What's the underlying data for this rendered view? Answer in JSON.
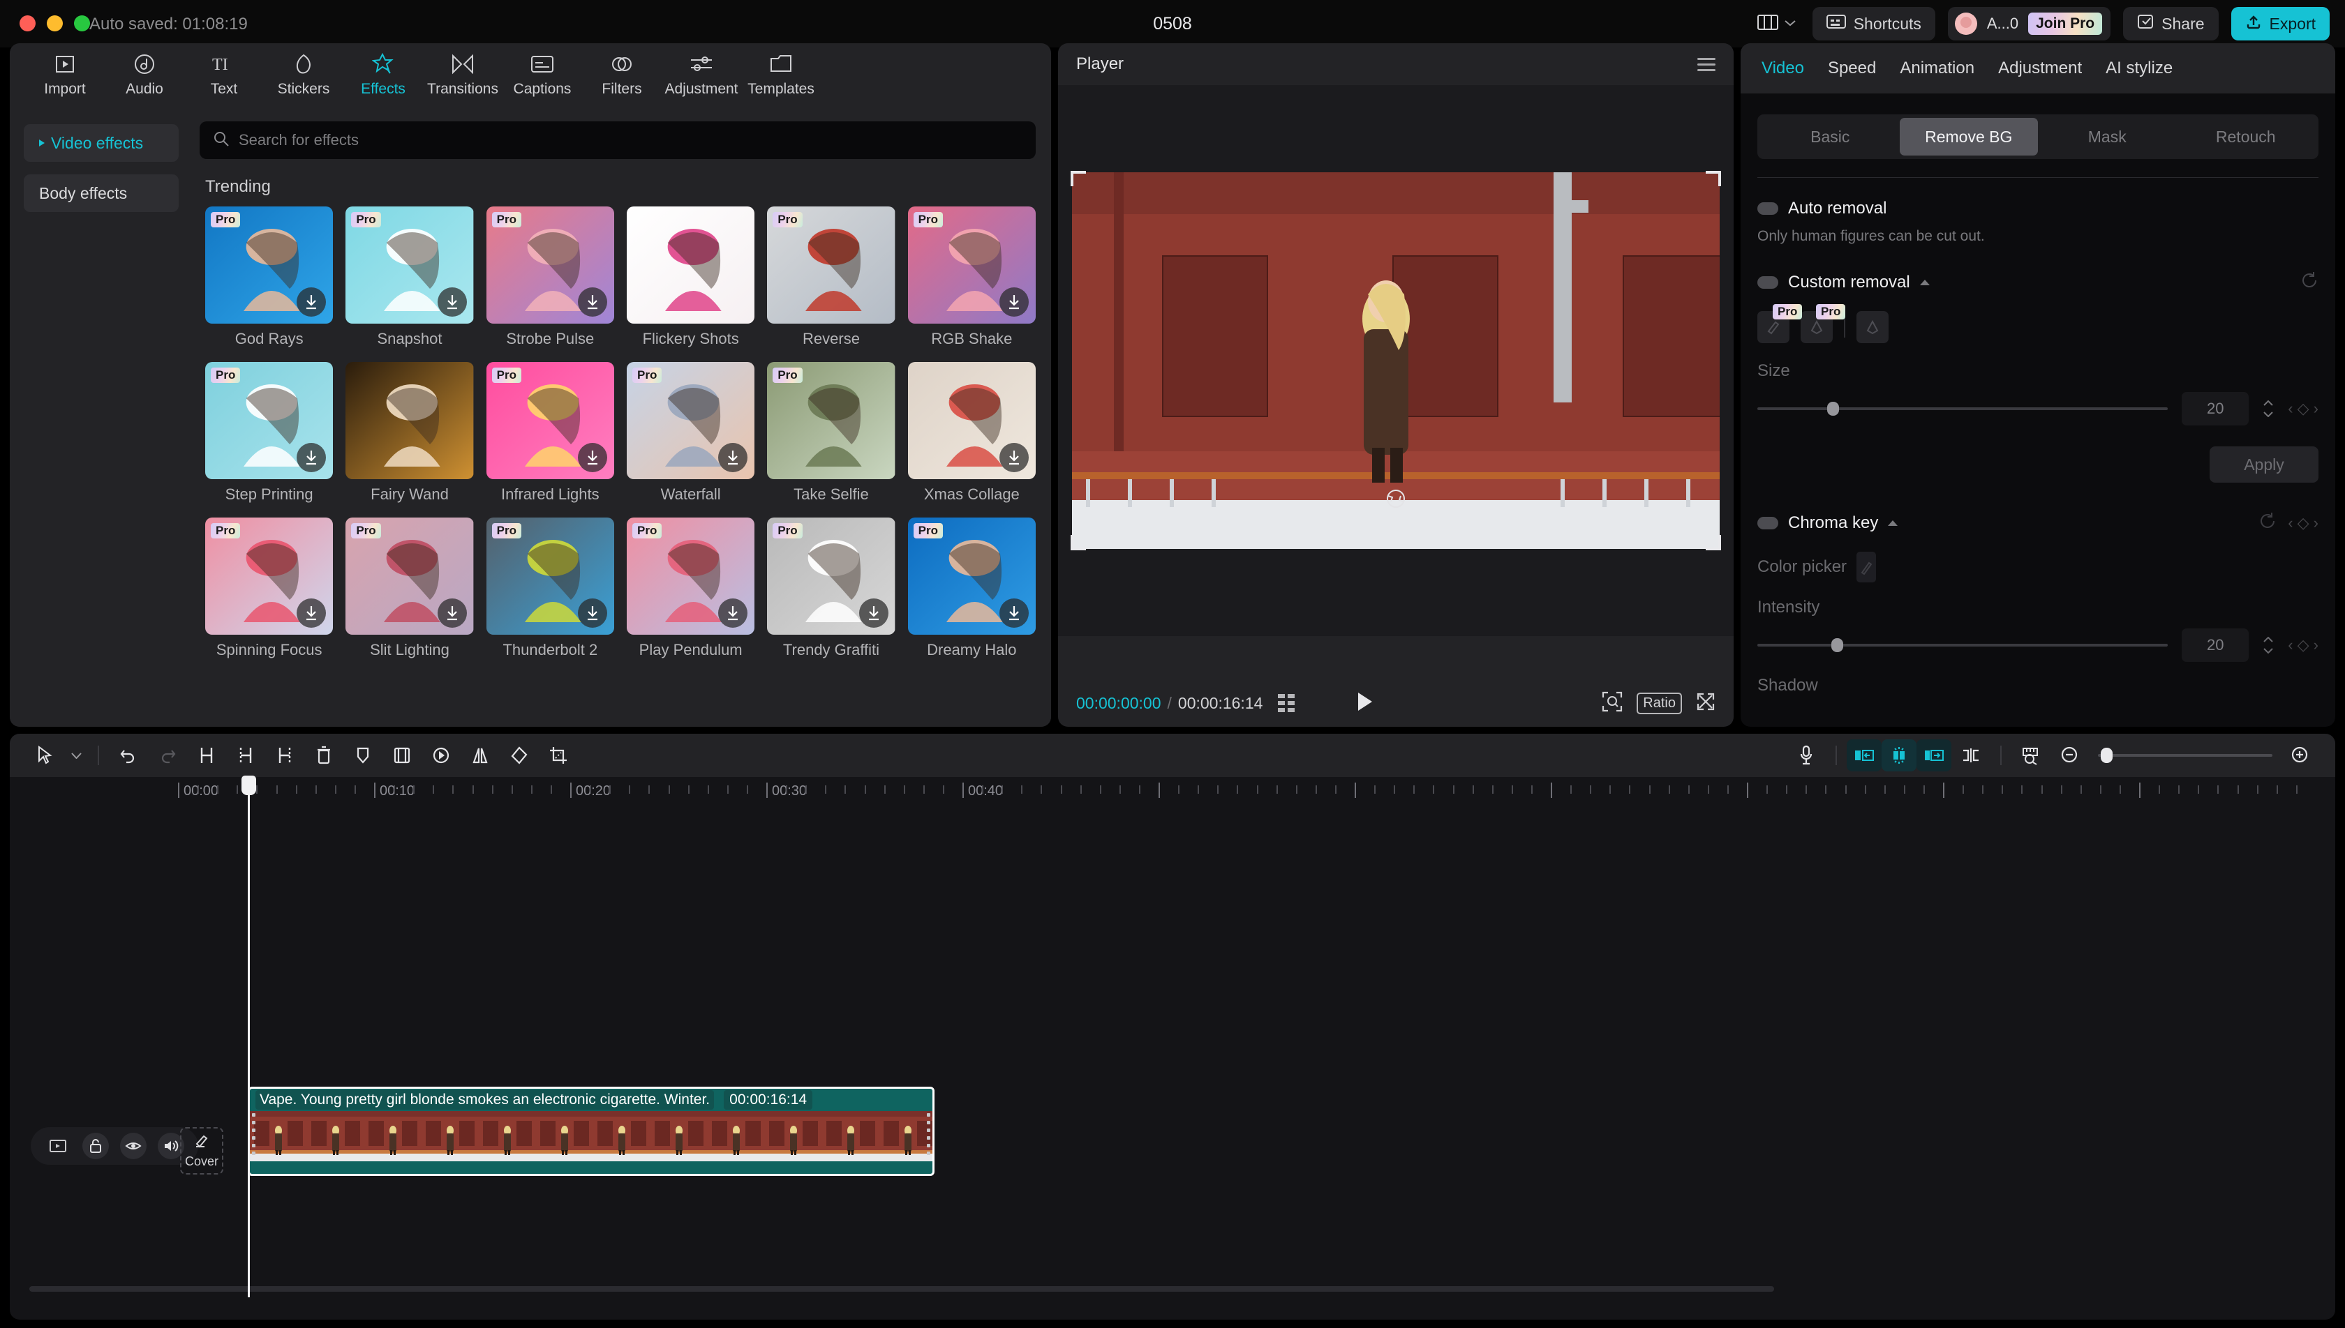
{
  "titlebar": {
    "autosave": "Auto saved: 01:08:19",
    "project_title": "0508",
    "layout_icon": "layout-icon",
    "chevron_icon": "chevron-down-icon",
    "shortcuts_label": "Shortcuts",
    "shortcuts_icon": "keyboard-icon",
    "account_name": "A...0",
    "join_pro_label": "Join Pro",
    "share_label": "Share",
    "share_icon": "share-icon",
    "export_label": "Export",
    "export_icon": "upload-icon",
    "accent_color": "#16c2d4"
  },
  "modebar": {
    "items": [
      {
        "label": "Import",
        "icon": "import-icon",
        "active": false
      },
      {
        "label": "Audio",
        "icon": "audio-note-icon",
        "active": false
      },
      {
        "label": "Text",
        "icon": "text-ti-icon",
        "active": false
      },
      {
        "label": "Stickers",
        "icon": "sticker-icon",
        "active": false
      },
      {
        "label": "Effects",
        "icon": "effects-star-icon",
        "active": true
      },
      {
        "label": "Transitions",
        "icon": "transitions-icon",
        "active": false
      },
      {
        "label": "Captions",
        "icon": "captions-icon",
        "active": false
      },
      {
        "label": "Filters",
        "icon": "filters-icon",
        "active": false
      },
      {
        "label": "Adjustment",
        "icon": "adjustment-sliders-icon",
        "active": false
      },
      {
        "label": "Templates",
        "icon": "templates-icon",
        "active": false
      }
    ]
  },
  "effects_panel": {
    "categories": [
      {
        "label": "Video effects",
        "selected": true
      },
      {
        "label": "Body effects",
        "selected": false
      }
    ],
    "search": {
      "placeholder": "Search for effects",
      "value": "",
      "icon": "search-icon"
    },
    "section_title": "Trending",
    "pro_badge": "Pro",
    "download_icon": "download-icon",
    "items": [
      {
        "name": "God Rays",
        "pro": true,
        "download": true,
        "c1": "#1277c4",
        "c2": "#2fa5e8",
        "skin": "#e7b99a"
      },
      {
        "name": "Snapshot",
        "pro": true,
        "download": true,
        "c1": "#7fd8e4",
        "c2": "#a9e7ef",
        "skin": "#ffffff"
      },
      {
        "name": "Strobe Pulse",
        "pro": true,
        "download": true,
        "c1": "#e87a88",
        "c2": "#9f86d8",
        "skin": "#f2b1b9"
      },
      {
        "name": "Flickery Shots",
        "pro": false,
        "download": false,
        "c1": "#ffffff",
        "c2": "#f6f0f2",
        "skin": "#e0448a"
      },
      {
        "name": "Reverse",
        "pro": true,
        "download": false,
        "c1": "#d6d8da",
        "c2": "#b4bcc6",
        "skin": "#c0392b"
      },
      {
        "name": "RGB Shake",
        "pro": true,
        "download": true,
        "c1": "#e36a87",
        "c2": "#8f7ac8",
        "skin": "#f4a6b0"
      },
      {
        "name": "Step Printing",
        "pro": true,
        "download": true,
        "c1": "#7fd0dd",
        "c2": "#a7e3ec",
        "skin": "#ffffff"
      },
      {
        "name": "Fairy Wand",
        "pro": false,
        "download": false,
        "c1": "#2a1c0c",
        "c2": "#cf9132",
        "skin": "#f0dcc2"
      },
      {
        "name": "Infrared Lights",
        "pro": true,
        "download": true,
        "c1": "#ff4d9e",
        "c2": "#ff7ec0",
        "skin": "#ffd36b"
      },
      {
        "name": "Waterfall",
        "pro": true,
        "download": true,
        "c1": "#c6d3e6",
        "c2": "#e9c4ae",
        "skin": "#9aa7bd"
      },
      {
        "name": "Take Selfie",
        "pro": true,
        "download": false,
        "c1": "#8b9a74",
        "c2": "#c9d6c0",
        "skin": "#6b7a55"
      },
      {
        "name": "Xmas Collage",
        "pro": false,
        "download": true,
        "c1": "#ded3c8",
        "c2": "#efe7dd",
        "skin": "#d94f45"
      },
      {
        "name": "Spinning Focus",
        "pro": true,
        "download": true,
        "c1": "#ef8fa2",
        "c2": "#cfd6ec",
        "skin": "#e9566f"
      },
      {
        "name": "Slit Lighting",
        "pro": true,
        "download": true,
        "c1": "#d8a3ad",
        "c2": "#b9a8c4",
        "skin": "#bf4d63"
      },
      {
        "name": "Thunderbolt 2",
        "pro": true,
        "download": true,
        "c1": "#55606a",
        "c2": "#3aa0d6",
        "skin": "#cdd93a"
      },
      {
        "name": "Play Pendulum",
        "pro": true,
        "download": true,
        "c1": "#ef8fa2",
        "c2": "#b9bfe2",
        "skin": "#e55f7a"
      },
      {
        "name": "Trendy Graffiti",
        "pro": true,
        "download": true,
        "c1": "#b9b9b9",
        "c2": "#d7d7d7",
        "skin": "#ffffff"
      },
      {
        "name": "Dreamy Halo",
        "pro": true,
        "download": true,
        "c1": "#0d6cc0",
        "c2": "#2f9ce4",
        "skin": "#e7b99a"
      }
    ]
  },
  "player": {
    "title": "Player",
    "menu_icon": "hamburger-menu-icon",
    "rotate_icon": "rotate-icon",
    "current_time": "00:00:00:00",
    "time_separator": "/",
    "total_time": "00:00:16:14",
    "quality_icon": "quality-grid-icon",
    "play_icon": "play-icon",
    "zoom_icon": "zoom-fit-icon",
    "ratio_label": "Ratio",
    "fullscreen_icon": "fullscreen-icon"
  },
  "properties": {
    "tabs": [
      {
        "label": "Video",
        "active": true
      },
      {
        "label": "Speed",
        "active": false
      },
      {
        "label": "Animation",
        "active": false
      },
      {
        "label": "Adjustment",
        "active": false
      },
      {
        "label": "AI stylize",
        "active": false
      }
    ],
    "segments": [
      {
        "label": "Basic",
        "active": false
      },
      {
        "label": "Remove BG",
        "active": true
      },
      {
        "label": "Mask",
        "active": false
      },
      {
        "label": "Retouch",
        "active": false
      }
    ],
    "auto_removal": {
      "label": "Auto removal",
      "enabled": false,
      "hint": "Only human figures can be cut out."
    },
    "custom_removal": {
      "label": "Custom removal",
      "enabled": false,
      "collapse_icon": "triangle-up-icon",
      "reset_icon": "reset-icon",
      "tools": [
        {
          "icon": "brush-keep-icon",
          "pro": true
        },
        {
          "icon": "brush-erase-icon",
          "pro": true
        },
        {
          "icon": "eraser-icon",
          "pro": false
        }
      ],
      "size_label": "Size",
      "size_value": "20",
      "apply_label": "Apply"
    },
    "chroma_key": {
      "label": "Chroma key",
      "enabled": false,
      "collapse_icon": "triangle-up-icon",
      "reset_icon": "reset-icon",
      "color_picker_label": "Color picker",
      "color_picker_icon": "eyedropper-icon",
      "intensity_label": "Intensity",
      "intensity_value": "20",
      "shadow_label": "Shadow"
    }
  },
  "timeline": {
    "toolbar_left": [
      {
        "icon": "cursor-select-icon",
        "name": "select-tool"
      },
      {
        "icon": "chevron-down-icon",
        "name": "select-tool-dropdown"
      },
      {
        "icon": "undo-icon",
        "name": "undo-button"
      },
      {
        "icon": "redo-icon",
        "name": "redo-button"
      },
      {
        "icon": "split-icon",
        "name": "split-button"
      },
      {
        "icon": "trim-left-icon",
        "name": "trim-start-button"
      },
      {
        "icon": "trim-right-icon",
        "name": "trim-end-button"
      },
      {
        "icon": "delete-icon",
        "name": "delete-button"
      },
      {
        "icon": "marker-icon",
        "name": "marker-button"
      },
      {
        "icon": "crop-frame-icon",
        "name": "crop-button"
      },
      {
        "icon": "speed-icon",
        "name": "speed-button"
      },
      {
        "icon": "mirror-icon",
        "name": "mirror-button"
      },
      {
        "icon": "rotate-shape-icon",
        "name": "rotate-button"
      },
      {
        "icon": "crop-icon",
        "name": "crop-tool-button"
      }
    ],
    "toolbar_right": [
      {
        "icon": "microphone-icon",
        "name": "record-voiceover-button",
        "highlight": "none"
      },
      {
        "icon": "snap-left-icon",
        "name": "snap-left-button",
        "highlight": "box"
      },
      {
        "icon": "auto-snap-icon",
        "name": "auto-snap-button",
        "highlight": "box-on"
      },
      {
        "icon": "snap-right-icon",
        "name": "snap-right-button",
        "highlight": "box"
      },
      {
        "icon": "gap-detect-icon",
        "name": "gap-detect-button",
        "highlight": "none"
      },
      {
        "icon": "ruler-zoom-icon",
        "name": "fit-timeline-button",
        "highlight": "none"
      },
      {
        "icon": "zoom-out-icon",
        "name": "zoom-out-button",
        "highlight": "none"
      },
      {
        "icon": "zoom-in-icon",
        "name": "zoom-in-button",
        "highlight": "none"
      }
    ],
    "ruler_labels": [
      "00:00",
      "00:10",
      "00:20",
      "00:30",
      "00:40"
    ],
    "track_controls": [
      {
        "icon": "track-video-icon",
        "name": "track-type-icon"
      },
      {
        "icon": "unlock-icon",
        "name": "lock-track-button"
      },
      {
        "icon": "eye-icon",
        "name": "hide-track-button"
      },
      {
        "icon": "speaker-icon",
        "name": "mute-track-button"
      }
    ],
    "cover": {
      "label": "Cover",
      "icon": "pencil-icon"
    },
    "clip": {
      "title": "Vape. Young pretty girl blonde smokes an electronic cigarette. Winter.",
      "duration": "00:00:16:14",
      "color": "#0f6460"
    }
  }
}
